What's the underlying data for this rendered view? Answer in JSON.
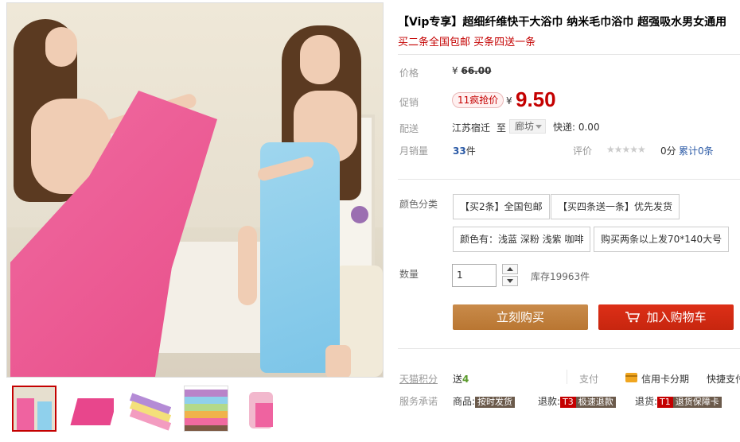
{
  "product": {
    "title": "【Vip专享】超细纤维快干大浴巾 纳米毛巾浴巾 超强吸水男女通用",
    "subtitle": "买二条全国包邮 买条四送一条"
  },
  "price": {
    "label": "价格",
    "currency": "¥",
    "original": "66.00"
  },
  "promo": {
    "label": "促销",
    "badge": "11疯抢价",
    "currency": "¥",
    "price": "9.50"
  },
  "delivery": {
    "label": "配送",
    "from": "江苏宿迁",
    "to_word": "至",
    "to_city": "廊坊",
    "shipping": "快递: 0.00"
  },
  "sales": {
    "label": "月销量",
    "count": "33",
    "unit": "件",
    "rating_label": "评价",
    "stars": "★★★★★",
    "score": "0分",
    "review_count": "累计0条"
  },
  "options": {
    "label": "颜色分类",
    "items": [
      "【买2条】全国包邮",
      "【买四条送一条】优先发货",
      "颜色有：浅蓝 深粉 浅紫 咖啡",
      "购买两条以上发70*140大号"
    ]
  },
  "quantity": {
    "label": "数量",
    "value": "1",
    "stock": "库存19963件"
  },
  "actions": {
    "buy_label": "立刻购买",
    "cart_label": "加入购物车"
  },
  "service": {
    "points_label": "天猫积分",
    "points_prefix": "送",
    "points_value": "4",
    "pay_label": "支付",
    "card_label": "信用卡分期",
    "quick_label": "快捷支付",
    "promise_label": "服务承诺",
    "goods_prefix": "商品:",
    "goods_tag": "按时发货",
    "refund_prefix": "退款:",
    "refund_badge": "T3",
    "refund_tag": "极速退款",
    "return_prefix": "退货:",
    "return_badge": "T1",
    "return_tag": "退货保障卡"
  },
  "colors": {
    "accent_red": "#c40000",
    "buy_brown": "#b97632",
    "cart_red": "#dd2f17"
  }
}
